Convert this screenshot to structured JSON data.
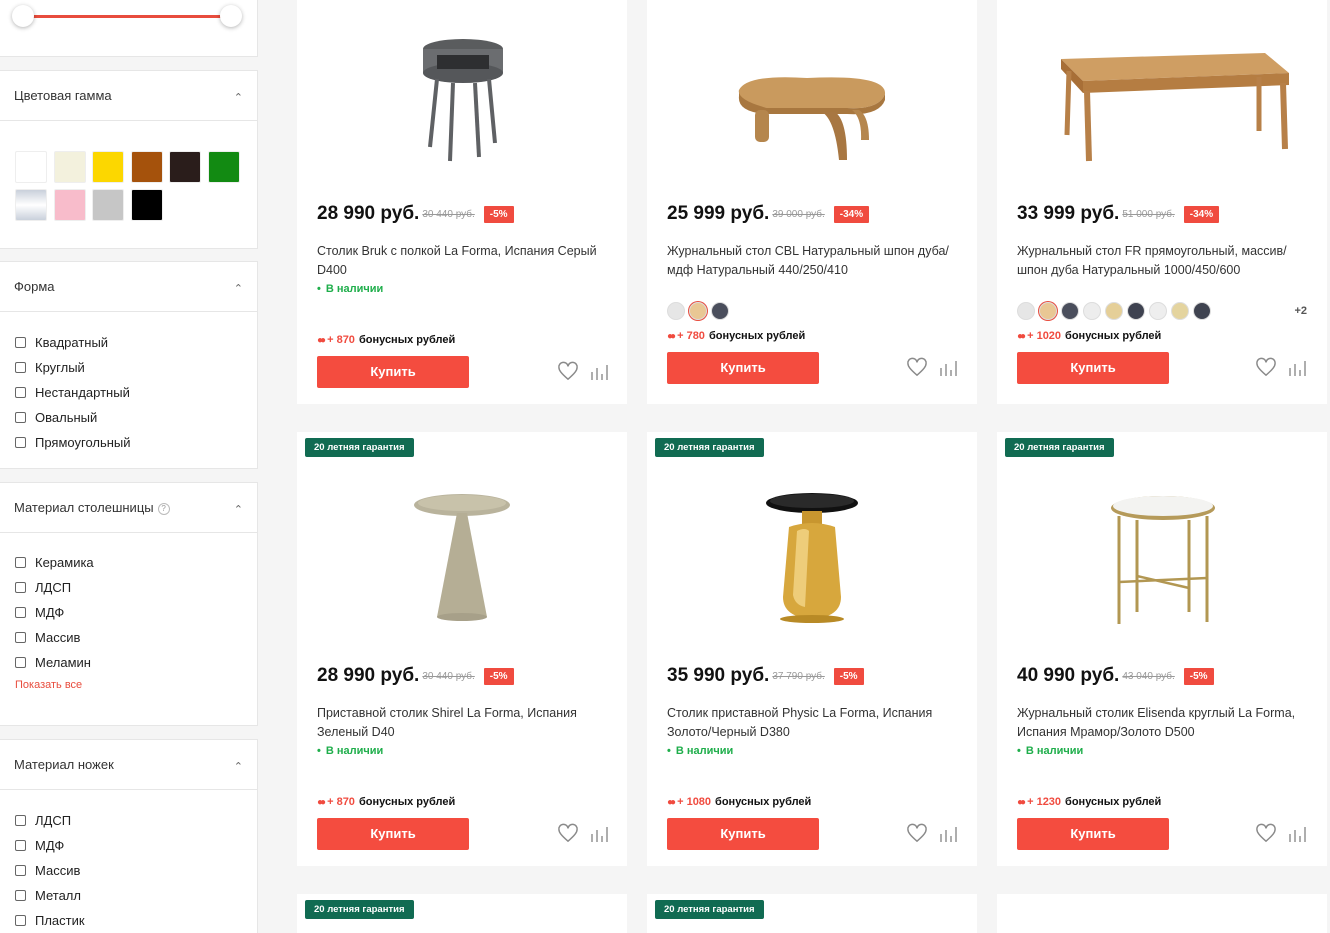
{
  "sidebar": {
    "color_filter": {
      "title": "Цветовая гамма",
      "swatches": [
        {
          "name": "white",
          "color": "#ffffff"
        },
        {
          "name": "ivory",
          "color": "#f3f1dd"
        },
        {
          "name": "yellow",
          "color": "#fcd700"
        },
        {
          "name": "brown",
          "color": "#a5520c"
        },
        {
          "name": "dark-brown",
          "color": "#2a1d1b"
        },
        {
          "name": "green",
          "color": "#128a12"
        },
        {
          "name": "silver",
          "color": "#dde2ea"
        },
        {
          "name": "pink",
          "color": "#f8bccb"
        },
        {
          "name": "gray",
          "color": "#c6c6c6"
        },
        {
          "name": "black",
          "color": "#000000"
        }
      ]
    },
    "shape_filter": {
      "title": "Форма",
      "options": [
        "Квадратный",
        "Круглый",
        "Нестандартный",
        "Овальный",
        "Прямоугольный"
      ]
    },
    "top_material_filter": {
      "title": "Материал столешницы",
      "help": "?",
      "options": [
        "Керамика",
        "ЛДСП",
        "МДФ",
        "Массив",
        "Меламин"
      ],
      "show_all": "Показать все"
    },
    "legs_material_filter": {
      "title": "Материал ножек",
      "options": [
        "ЛДСП",
        "МДФ",
        "Массив",
        "Металл",
        "Пластик"
      ]
    }
  },
  "products": [
    {
      "price": "28 990 руб.",
      "old_price": "30 440 руб.",
      "discount": "-5%",
      "title": "Столик Bruk с полкой La Forma, Испания Серый D400",
      "stock": "В наличии",
      "bonus_amount": "+ 870",
      "bonus_text": "бонусных рублей",
      "buy": "Купить"
    },
    {
      "price": "25 999 руб.",
      "old_price": "39 000 руб.",
      "discount": "-34%",
      "title": "Журнальный стол CBL Натуральный шпон дуба/мдф Натуральный 440/250/410",
      "color_dots": [
        "#e6e6e6",
        "#e9c794",
        "#4a4e5c"
      ],
      "bonus_amount": "+ 780",
      "bonus_text": "бонусных рублей",
      "buy": "Купить"
    },
    {
      "price": "33 999 руб.",
      "old_price": "51 000 руб.",
      "discount": "-34%",
      "title": "Журнальный стол FR прямоугольный, массив/шпон дуба Натуральный 1000/450/600",
      "color_dots": [
        "#e6e6e6",
        "#e9c794",
        "#4a4e5c",
        "#ededed",
        "#e5cf98",
        "#3e4250",
        "#eeeeee",
        "#e4d49f",
        "#3f4350"
      ],
      "more": "+2",
      "bonus_amount": "+ 1020",
      "bonus_text": "бонусных рублей",
      "buy": "Купить"
    },
    {
      "badge": "20 летняя гарантия",
      "price": "28 990 руб.",
      "old_price": "30 440 руб.",
      "discount": "-5%",
      "title": "Приставной столик Shirel La Forma, Испания Зеленый D40",
      "stock": "В наличии",
      "bonus_amount": "+ 870",
      "bonus_text": "бонусных рублей",
      "buy": "Купить"
    },
    {
      "badge": "20 летняя гарантия",
      "price": "35 990 руб.",
      "old_price": "37 790 руб.",
      "discount": "-5%",
      "title": "Столик приставной Physic La Forma, Испания Золото/Черный D380",
      "stock": "В наличии",
      "bonus_amount": "+ 1080",
      "bonus_text": "бонусных рублей",
      "buy": "Купить"
    },
    {
      "badge": "20 летняя гарантия",
      "price": "40 990 руб.",
      "old_price": "43 040 руб.",
      "discount": "-5%",
      "title": "Журнальный столик Elisenda круглый La Forma, Испания Мрамор/Золото D500",
      "stock": "В наличии",
      "bonus_amount": "+ 1230",
      "bonus_text": "бонусных рублей",
      "buy": "Купить"
    },
    {
      "badge": "20 летняя гарантия"
    },
    {
      "badge": "20 летняя гарантия"
    },
    {}
  ]
}
